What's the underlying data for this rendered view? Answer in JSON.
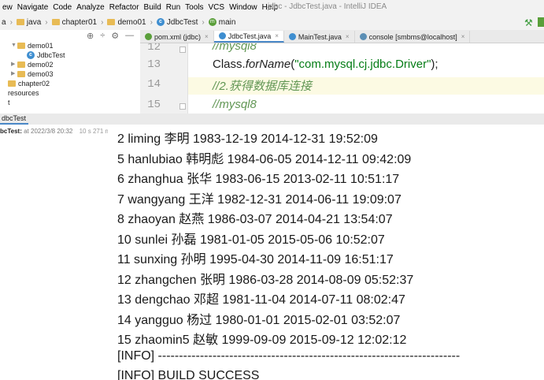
{
  "menu": {
    "items": [
      "ew",
      "Navigate",
      "Code",
      "Analyze",
      "Refactor",
      "Build",
      "Run",
      "Tools",
      "VCS",
      "Window",
      "Help"
    ],
    "window_title": "jdbc - JdbcTest.java - IntelliJ IDEA"
  },
  "breadcrumbs": {
    "items": [
      "a",
      "java",
      "chapter01",
      "demo01",
      "JdbcTest",
      "main"
    ]
  },
  "project": {
    "tree": [
      {
        "label": "demo01",
        "indent": 1,
        "arrow": "▼",
        "icon": "folder"
      },
      {
        "label": "JdbcTest",
        "indent": 2,
        "arrow": "",
        "icon": "class"
      },
      {
        "label": "demo02",
        "indent": 1,
        "arrow": "▶",
        "icon": "folder"
      },
      {
        "label": "demo03",
        "indent": 1,
        "arrow": "▶",
        "icon": "folder"
      },
      {
        "label": "chapter02",
        "indent": 0,
        "arrow": "",
        "icon": "folder"
      },
      {
        "label": "resources",
        "indent": 0,
        "arrow": "",
        "icon": "none"
      },
      {
        "label": "t",
        "indent": 0,
        "arrow": "",
        "icon": "none"
      }
    ]
  },
  "tabs": [
    {
      "label": "pom.xml (jdbc)",
      "icon": "maven-icon",
      "color": "#5a9f3a",
      "active": false
    },
    {
      "label": "JdbcTest.java",
      "icon": "class-icon",
      "color": "#3e8ed0",
      "active": true
    },
    {
      "label": "MainTest.java",
      "icon": "class-icon",
      "color": "#3e8ed0",
      "active": false
    },
    {
      "label": "console [smbms@localhost]",
      "icon": "console-icon",
      "color": "#5b8fb5",
      "active": false
    }
  ],
  "editor": {
    "lines": [
      {
        "num": "12",
        "kind": "comment",
        "text": "//mysql8"
      },
      {
        "num": "13",
        "kind": "code",
        "prefix": "Class.",
        "method": "forName",
        "open": "(",
        "string": "\"com.mysql.cj.jdbc.Driver\"",
        "close": ");"
      },
      {
        "num": "14",
        "kind": "comment",
        "text": "//2.获得数据库连接"
      },
      {
        "num": "15",
        "kind": "comment",
        "text": "//mysql8"
      }
    ]
  },
  "bottom": {
    "title": "dbcTest",
    "run_item": {
      "name": "bcTest:",
      "date": "at 2022/3/8 20:32",
      "duration": "10 s 271 ms"
    }
  },
  "console": {
    "lines": [
      "2  liming  李明 1983-12-19 2014-12-31 19:52:09",
      "5  hanlubiao    韩明彪  1984-06-05 2014-12-11 09:42:09",
      "6  zhanghua    张华 1983-06-15 2013-02-11 10:51:17",
      "7  wangyang   王洋 1982-12-31 2014-06-11 19:09:07",
      "8  zhaoyan   赵燕 1986-03-07 2014-04-21 13:54:07",
      "10    sunlei   孙磊 1981-01-05 2015-05-06 10:52:07",
      "11    sunxing    孙明 1995-04-30 2014-11-09 16:51:17",
      "12    zhangchen   张明 1986-03-28 2014-08-09 05:52:37",
      "13    dengchao    邓超 1981-11-04 2014-07-11 08:02:47",
      "14    yangguo  杨过 1980-01-01 2015-02-01 03:52:07",
      "15    zhaomin5     赵敏 1999-09-09 2015-09-12 12:02:12",
      "[INFO] ------------------------------------------------------------------------",
      "[INFO] BUILD SUCCESS"
    ]
  }
}
